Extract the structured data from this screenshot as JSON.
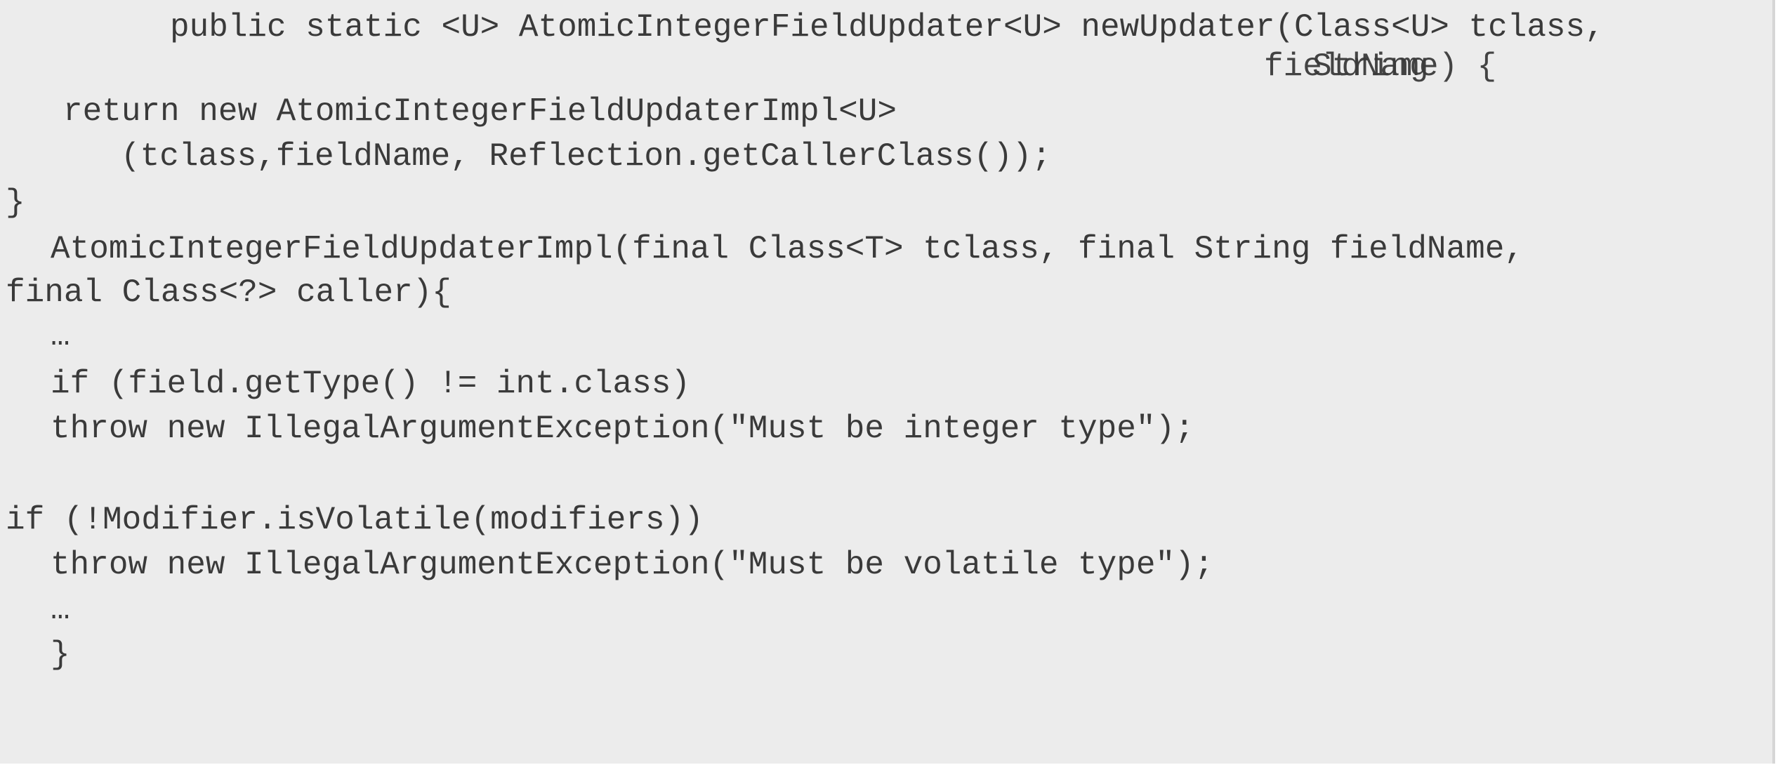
{
  "code": {
    "lines": [
      "public static <U> AtomicIntegerFieldUpdater<U> newUpdater(Class<U> tclass,",
      "fieldName) {",
      "return new AtomicIntegerFieldUpdaterImpl<U>",
      "(tclass,fieldName, Reflection.getCallerClass());",
      "}",
      "AtomicIntegerFieldUpdaterImpl(final Class<T> tclass, final String fieldName,",
      "final Class<?> caller){",
      "…",
      "if (field.getType() != int.class)",
      "throw new IllegalArgumentException(\"Must be integer type\");",
      "if (!Modifier.isVolatile(modifiers))",
      "throw new IllegalArgumentException(\"Must be volatile type\");",
      "…",
      "}"
    ],
    "overlay_text": "String"
  }
}
